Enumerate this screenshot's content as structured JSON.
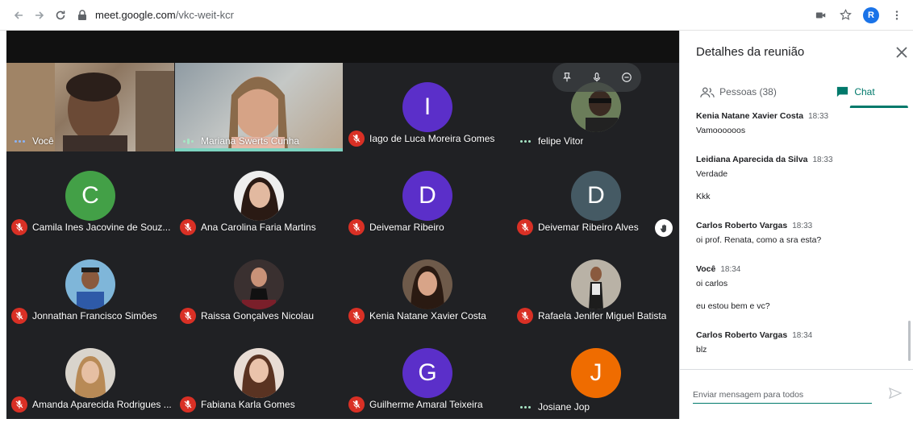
{
  "browser": {
    "url_domain": "meet.google.com",
    "url_path": "/vkc-weit-kcr",
    "profile_initial": "R"
  },
  "panel": {
    "title": "Detalhes da reunião",
    "tab_people": "Pessoas (38)",
    "tab_chat": "Chat",
    "input_placeholder": "Enviar mensagem para todos"
  },
  "participants": [
    {
      "name": "Você",
      "audio": "speaking",
      "kind": "video"
    },
    {
      "name": "Mariana Swerts Cunha",
      "audio": "speaking-active",
      "kind": "video"
    },
    {
      "name": "Iago de Luca Moreira Gomes",
      "audio": "muted",
      "kind": "initial",
      "initial": "I",
      "color": "#5b2fc9"
    },
    {
      "name": "felipe Vitor",
      "audio": "speaking",
      "kind": "photo"
    },
    {
      "name": "Camila Ines Jacovine de Souz...",
      "audio": "muted",
      "kind": "initial",
      "initial": "C",
      "color": "#43a047"
    },
    {
      "name": "Ana Carolina Faria Martins",
      "audio": "muted",
      "kind": "photo"
    },
    {
      "name": "Deivemar Ribeiro",
      "audio": "muted",
      "kind": "initial",
      "initial": "D",
      "color": "#5b2fc9"
    },
    {
      "name": "Deivemar Ribeiro Alves",
      "audio": "muted",
      "kind": "initial",
      "initial": "D",
      "color": "#455a64"
    },
    {
      "name": "Jonnathan Francisco Simões",
      "audio": "muted",
      "kind": "photo"
    },
    {
      "name": "Raissa Gonçalves Nicolau",
      "audio": "muted",
      "kind": "photo"
    },
    {
      "name": "Kenia Natane Xavier Costa",
      "audio": "muted",
      "kind": "photo"
    },
    {
      "name": "Rafaela Jenifer Miguel Batista",
      "audio": "muted",
      "kind": "photo"
    },
    {
      "name": "Amanda Aparecida Rodrigues ...",
      "audio": "muted",
      "kind": "photo"
    },
    {
      "name": "Fabiana Karla Gomes",
      "audio": "muted",
      "kind": "photo"
    },
    {
      "name": "Guilherme Amaral Teixeira",
      "audio": "muted",
      "kind": "initial",
      "initial": "G",
      "color": "#5b2fc9"
    },
    {
      "name": "Josiane Jop",
      "audio": "idle",
      "kind": "initial",
      "initial": "J",
      "color": "#ef6c00"
    }
  ],
  "messages": [
    {
      "sender": "Kenia Natane Xavier Costa",
      "time": "18:33",
      "lines": [
        "Vamoooooos"
      ]
    },
    {
      "sender": "Leidiana Aparecida da Silva",
      "time": "18:33",
      "lines": [
        "Verdade",
        "Kkk"
      ]
    },
    {
      "sender": "Carlos Roberto Vargas",
      "time": "18:33",
      "lines": [
        "oi prof. Renata, como a sra esta?"
      ]
    },
    {
      "sender": "Você",
      "time": "18:34",
      "lines": [
        "oi carlos",
        "eu estou bem e vc?"
      ]
    },
    {
      "sender": "Carlos Roberto Vargas",
      "time": "18:34",
      "lines": [
        "blz"
      ]
    }
  ]
}
